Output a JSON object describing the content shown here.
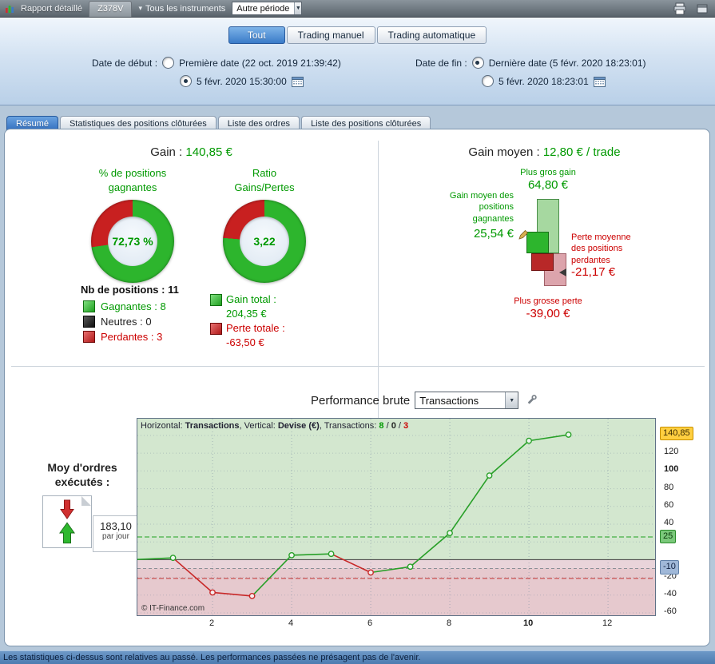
{
  "toolbar": {
    "title": "Rapport détaillé",
    "tab": "Z378V",
    "instruments": "Tous les instruments",
    "period_select": "Autre période"
  },
  "icons": {
    "caret_down": "▾",
    "select_arrow": "▼"
  },
  "filters": {
    "mode_buttons": [
      {
        "label": "Tout"
      },
      {
        "label": "Trading manuel"
      },
      {
        "label": "Trading automatique"
      }
    ],
    "start": {
      "label": "Date de début :",
      "first_option": "Première date (22 oct. 2019 21:39:42)",
      "first_checked": false,
      "custom_option": "5 févr. 2020 15:30:00",
      "custom_checked": true
    },
    "end": {
      "label": "Date de fin :",
      "last_option": "Dernière date (5 févr. 2020 18:23:01)",
      "last_checked": true,
      "custom_option": "5 févr. 2020 18:23:01",
      "custom_checked": false
    }
  },
  "tabs": [
    {
      "label": "Résumé"
    },
    {
      "label": "Statistiques des positions clôturées"
    },
    {
      "label": "Liste des ordres"
    },
    {
      "label": "Liste des positions clôturées"
    }
  ],
  "summary": {
    "gain_label": "Gain :",
    "gain_value": "140,85 €",
    "avg_label": "Gain moyen :",
    "avg_value": "12,80 € / trade",
    "winrate": {
      "title": "% de positions\ngagnantes",
      "value": "72,73 %",
      "green_pct": 72.73
    },
    "ratio": {
      "title": "Ratio\nGains/Pertes",
      "value": "3,22",
      "green_pct": 76.3
    },
    "positions": {
      "label": "Nb de positions :",
      "count": "11",
      "legend": [
        {
          "label": "Gagnantes :",
          "value": "8"
        },
        {
          "label": "Neutres :",
          "value": "0"
        },
        {
          "label": "Perdantes :",
          "value": "3"
        }
      ]
    },
    "totals": {
      "gain_label": "Gain total :",
      "gain_value": "204,35 €",
      "loss_label": "Perte totale :",
      "loss_value": "-63,50 €"
    },
    "extremes": {
      "max_gain_label": "Plus gros gain",
      "max_gain_value": "64,80 €",
      "max_gain": 64.8,
      "avg_gain_label": "Gain moyen des\npositions\ngagnantes",
      "avg_gain_value": "25,54 €",
      "avg_gain": 25.54,
      "avg_loss_label": "Perte moyenne\ndes positions\nperdantes",
      "avg_loss_value": "-21,17 €",
      "avg_loss": -21.17,
      "max_loss_label": "Plus grosse perte",
      "max_loss_value": "-39,00 €",
      "max_loss": -39.0
    }
  },
  "performance": {
    "title": "Performance brute",
    "select_value": "Transactions",
    "orders": {
      "label": "Moy d'ordres\nexécutés :",
      "value": "183,10",
      "unit": "par jour"
    }
  },
  "chart_data": {
    "type": "line",
    "header_segments": [
      {
        "text": "Horizontal: ",
        "style": "plain"
      },
      {
        "text": "Transactions",
        "style": "bold"
      },
      {
        "text": ", ",
        "style": "plain"
      },
      {
        "text": "Vertical: ",
        "style": "plain"
      },
      {
        "text": "Devise (€)",
        "style": "bold"
      },
      {
        "text": ", ",
        "style": "plain"
      },
      {
        "text": "Transactions: ",
        "style": "plain"
      },
      {
        "text": "8",
        "style": "win"
      },
      {
        "text": " / ",
        "style": "plain"
      },
      {
        "text": "0",
        "style": "neutral"
      },
      {
        "text": " / ",
        "style": "plain"
      },
      {
        "text": "3",
        "style": "loss"
      }
    ],
    "x": [
      1,
      2,
      3,
      4,
      5,
      6,
      7,
      8,
      9,
      10,
      11
    ],
    "cumulative": [
      2,
      -37,
      -41,
      5,
      6.5,
      -14.5,
      -8,
      30,
      94.8,
      134,
      140.85
    ],
    "results": [
      "win",
      "loss",
      "loss",
      "win",
      "win",
      "loss",
      "win",
      "win",
      "win",
      "win",
      "win"
    ],
    "start_point": {
      "x": 0,
      "y": 0
    },
    "final_value": 140.85,
    "ylim": [
      -62.7,
      158.9
    ],
    "xlim": [
      0.1,
      13.19
    ],
    "yticks": [
      120,
      100,
      80,
      60,
      40,
      -20,
      -40,
      -60
    ],
    "bold_ytick": 100,
    "ygrid": [
      140,
      120,
      100,
      80,
      60,
      40,
      20,
      -20,
      -40,
      -60
    ],
    "xticks": [
      2,
      4,
      6,
      8,
      10,
      12
    ],
    "bold_xtick": 10,
    "boxed_labels": [
      {
        "value": 140.85,
        "label": "140,85",
        "style": "yellow"
      },
      {
        "value": 25,
        "label": "25",
        "style": "green"
      },
      {
        "value": -10,
        "label": "-10",
        "style": "blue"
      }
    ],
    "ref_lines": [
      {
        "value": 25.54,
        "color": "#1fa01f",
        "dash": "6,3"
      },
      {
        "value": -21.17,
        "color": "#c03030",
        "dash": "6,3"
      },
      {
        "value": -10,
        "color": "#8a8f96",
        "dash": "4,3"
      },
      {
        "value": 0,
        "color": "#3c3c3c",
        "dash": ""
      }
    ],
    "copyright": "© IT-Finance.com",
    "colors": {
      "win": "#28a028",
      "loss": "#c82828",
      "bg_positive": "#d3e7cf",
      "bg_negative": "#e6c9ce",
      "bg_neutral_band": "#e9d4da"
    }
  },
  "footer": {
    "text": "Les statistiques ci-dessus sont relatives au passé. Les performances passées ne présagent pas de l'avenir."
  }
}
